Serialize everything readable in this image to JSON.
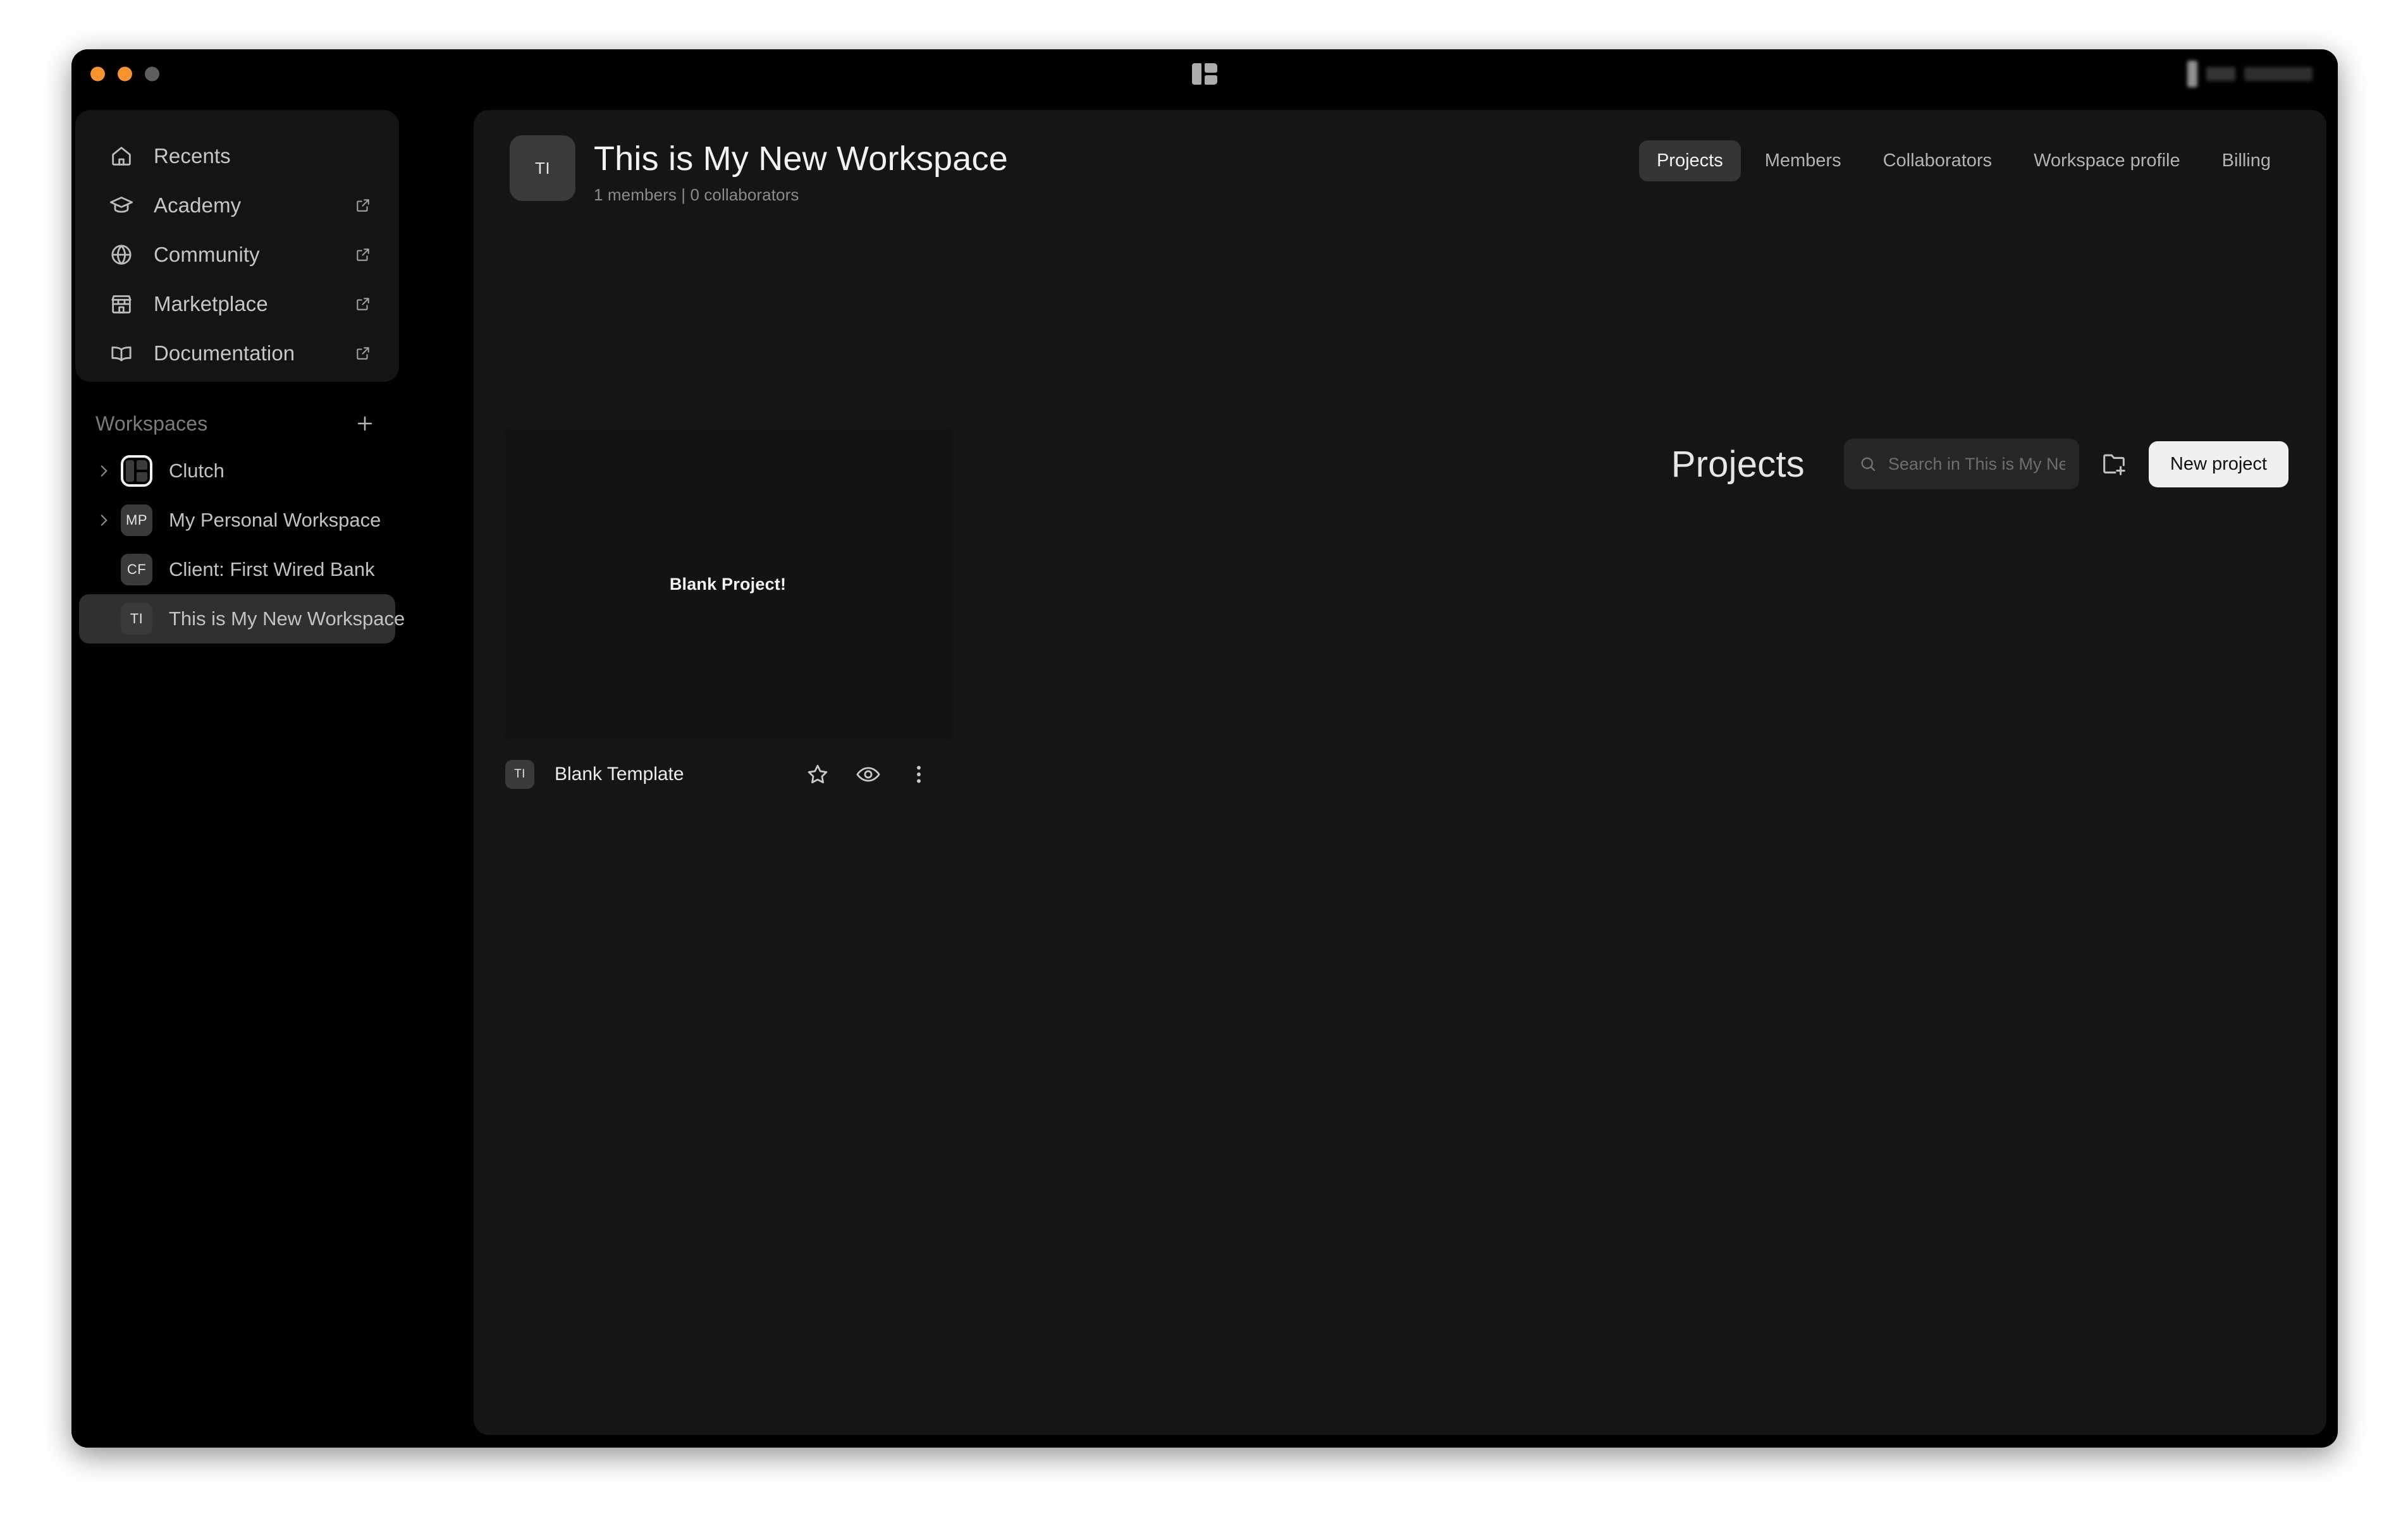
{
  "window": {
    "traffic_lights": [
      "close",
      "minimize",
      "zoom"
    ],
    "logo": "clutch-logo-icon"
  },
  "sidebar": {
    "nav": [
      {
        "label": "Recents",
        "icon": "home-icon",
        "external": false
      },
      {
        "label": "Academy",
        "icon": "graduation-cap-icon",
        "external": true
      },
      {
        "label": "Community",
        "icon": "globe-icon",
        "external": true
      },
      {
        "label": "Marketplace",
        "icon": "store-icon",
        "external": true
      },
      {
        "label": "Documentation",
        "icon": "book-open-icon",
        "external": true
      }
    ],
    "workspaces": {
      "title": "Workspaces",
      "add_label": "+",
      "items": [
        {
          "name": "Clutch",
          "avatar": "",
          "avatar_type": "logo",
          "expandable": true,
          "selected": false
        },
        {
          "name": "My Personal Workspace",
          "avatar": "MP",
          "avatar_type": "initials",
          "expandable": true,
          "selected": false
        },
        {
          "name": "Client: First Wired Bank",
          "avatar": "CF",
          "avatar_type": "initials",
          "expandable": false,
          "selected": false
        },
        {
          "name": "This is My New Workspace",
          "avatar": "TI",
          "avatar_type": "initials",
          "expandable": false,
          "selected": true
        }
      ]
    }
  },
  "header": {
    "badge": "TI",
    "title": "This is My New Workspace",
    "subtitle": "1 members | 0 collaborators",
    "tabs": [
      {
        "label": "Projects",
        "active": true
      },
      {
        "label": "Members",
        "active": false
      },
      {
        "label": "Collaborators",
        "active": false
      },
      {
        "label": "Workspace profile",
        "active": false
      },
      {
        "label": "Billing",
        "active": false
      }
    ]
  },
  "projects": {
    "title": "Projects",
    "search_placeholder": "Search in This is My Ne",
    "search_value": "",
    "new_folder_icon": "folder-plus-icon",
    "new_project_label": "New project",
    "cards": [
      {
        "thumbnail_text": "Blank Project!",
        "avatar": "TI",
        "name": "Blank Template",
        "actions": [
          "star-icon",
          "eye-icon",
          "more-vertical-icon"
        ]
      }
    ]
  },
  "colors": {
    "window_bg": "#000000",
    "panel_bg": "#151515",
    "nav_panel_bg": "#141414",
    "selected_row": "#303030",
    "accent_button": "#f0f0f0",
    "text_primary": "#f2f2f2",
    "text_secondary": "#8b8b8b",
    "traffic_orange": "#f79231",
    "traffic_gray": "#5c5f5c"
  }
}
